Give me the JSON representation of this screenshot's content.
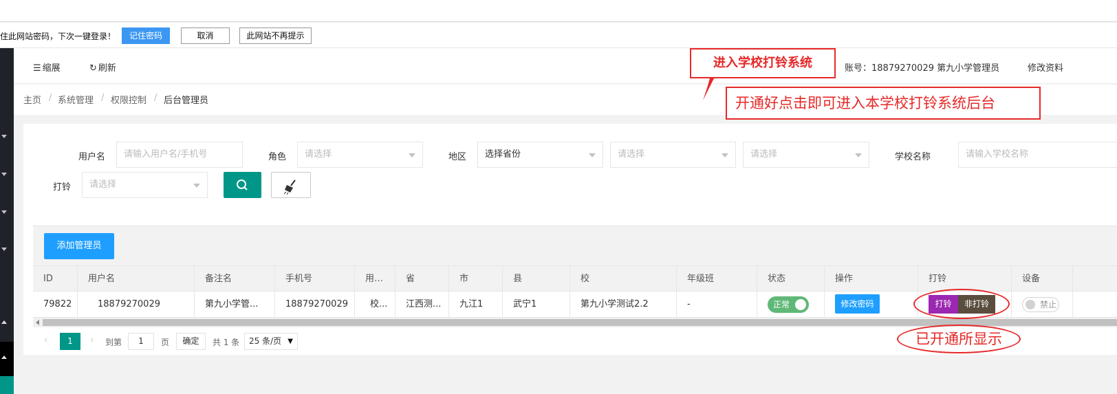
{
  "password_prompt": {
    "message": "住此网站密码，下次一键登录！",
    "remember_label": "记住密码",
    "cancel_label": "取消",
    "never_label": "此网站不再提示"
  },
  "header": {
    "collapse_label": "缩展",
    "refresh_label": "刷新",
    "enter_system_label": "进入学校打铃系统",
    "account_text": "账号：18879270029  第九小学管理员",
    "profile_label": "修改资料"
  },
  "breadcrumb": [
    "主页",
    "系统管理",
    "权限控制",
    "后台管理员"
  ],
  "annotations": {
    "top": "开通好点击即可进入本学校打铃系统后台",
    "bottom": "已开通所显示"
  },
  "filters": {
    "username_label": "用户名",
    "username_placeholder": "请输入用户名/手机号",
    "role_label": "角色",
    "role_placeholder": "请选择",
    "region_label": "地区",
    "province_value": "选择省份",
    "city_placeholder": "请选择",
    "county_placeholder": "请选择",
    "school_label": "学校名称",
    "school_placeholder": "请输入学校名称",
    "ring_label": "打铃",
    "ring_placeholder": "请选择"
  },
  "table": {
    "add_label": "添加管理员",
    "headers": [
      "ID",
      "用户名",
      "备注名",
      "手机号",
      "用…",
      "省",
      "市",
      "县",
      "校",
      "年级班",
      "状态",
      "操作",
      "打铃",
      "设备"
    ],
    "row": {
      "id": "79822",
      "username": "18879270029",
      "remark": "第九小学管...",
      "phone": "18879270029",
      "role": "校...",
      "province": "江西测...",
      "city": "九江1",
      "county": "武宁1",
      "school": "第九小学测试2.2",
      "grade": "-",
      "status_label": "正常",
      "op_label": "修改密码",
      "ring_label": "打铃",
      "nonring_label": "非打铃",
      "device_label": "禁止"
    }
  },
  "pager": {
    "page": "1",
    "goto_label": "到第",
    "goto_value": "1",
    "page_unit": "页",
    "confirm_label": "确定",
    "total_label": "共 1 条",
    "per_page": "25 条/页"
  }
}
